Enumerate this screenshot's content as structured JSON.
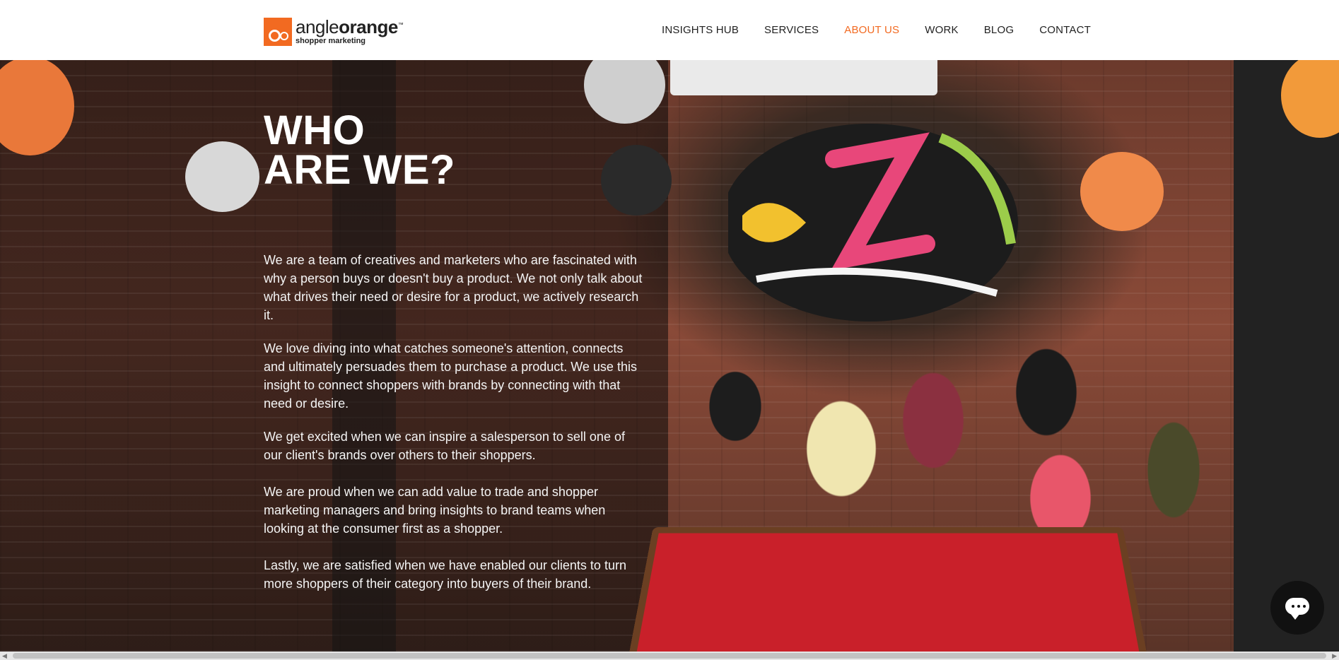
{
  "brand": {
    "name_light": "angle",
    "name_bold": "orange",
    "trademark": "™",
    "tagline": "shopper marketing",
    "accent": "#f26a21"
  },
  "nav": {
    "items": [
      {
        "label": "INSIGHTS HUB",
        "active": false
      },
      {
        "label": "SERVICES",
        "active": false
      },
      {
        "label": "ABOUT US",
        "active": true
      },
      {
        "label": "WORK",
        "active": false
      },
      {
        "label": "BLOG",
        "active": false
      },
      {
        "label": "CONTACT",
        "active": false
      }
    ]
  },
  "hero": {
    "title_line1": "WHO",
    "title_line2": "ARE WE?",
    "paragraphs": [
      "We are a team of creatives and marketers who are fascinated with why a person buys or doesn't buy a product. We not only talk about what drives their need or desire for a product, we actively research it.",
      "We love diving into what catches someone's attention, connects and ultimately persuades them to purchase a product. We use this insight to connect shoppers with brands by connecting with that need or desire.",
      "We get excited when we can inspire a salesperson to sell one of our client's brands over others to their shoppers.",
      "We are proud when we can add value to trade and shopper marketing managers and bring insights to brand teams when looking at the consumer first as a shopper.",
      "Lastly, we are satisfied when we have enabled our clients to turn more shoppers of their category into buyers of their brand."
    ]
  },
  "chat": {
    "icon": "chat-bubble-icon"
  },
  "scrollbar": {
    "left_arrow": "◀",
    "right_arrow": "▶"
  }
}
